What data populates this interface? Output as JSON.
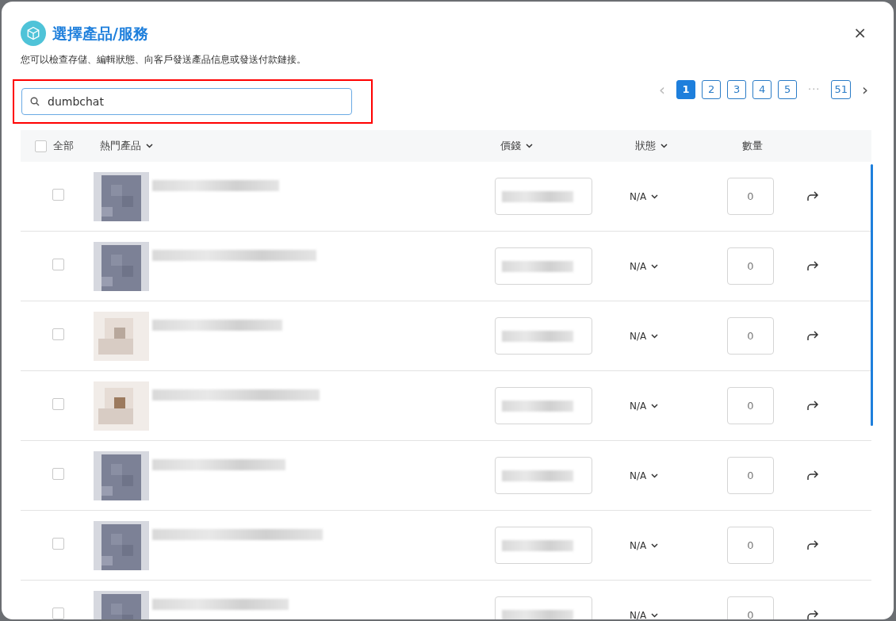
{
  "dialog": {
    "title": "選擇產品/服務",
    "subtitle": "您可以檢查存儲、編輯狀態、向客戶發送產品信息或發送付款鏈接。",
    "close": "×"
  },
  "search": {
    "value": "dumbchat",
    "highlighted": true
  },
  "pagination": {
    "prev": "‹",
    "next": "›",
    "ellipsis": "···",
    "pages": [
      {
        "label": "1",
        "selected": true
      },
      {
        "label": "2",
        "selected": false
      },
      {
        "label": "3",
        "selected": false
      },
      {
        "label": "4",
        "selected": false
      },
      {
        "label": "5",
        "selected": false
      },
      {
        "label": "51",
        "selected": false
      }
    ]
  },
  "table": {
    "select_all": {
      "label": "全部",
      "checked": false
    },
    "columns": [
      "熱門產品",
      "價錢",
      "狀態",
      "數量"
    ],
    "rows": [
      {
        "checked": false,
        "status": "N/A",
        "quantity": "0"
      },
      {
        "checked": false,
        "status": "N/A",
        "quantity": "0"
      },
      {
        "checked": false,
        "status": "N/A",
        "quantity": "0"
      },
      {
        "checked": false,
        "status": "N/A",
        "quantity": "0"
      },
      {
        "checked": false,
        "status": "N/A",
        "quantity": "0"
      },
      {
        "checked": false,
        "status": "N/A",
        "quantity": "0"
      },
      {
        "checked": false,
        "status": "N/A",
        "quantity": "0"
      }
    ]
  }
}
